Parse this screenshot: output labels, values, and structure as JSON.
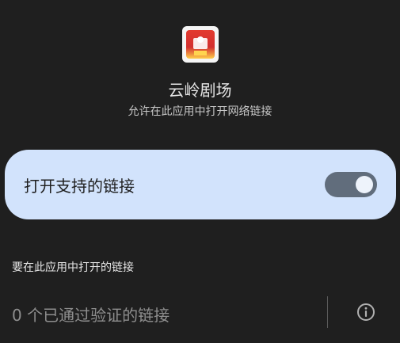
{
  "app": {
    "name": "云岭剧场",
    "icon_label": "云岭剧场",
    "subtitle": "允许在此应用中打开网络链接"
  },
  "setting": {
    "label": "打开支持的链接",
    "enabled": true,
    "accent_color": "#d2e3fc"
  },
  "links_section": {
    "title": "要在此应用中打开的链接",
    "verified_links_text": "0 个已通过验证的链接"
  },
  "icons": {
    "info": "info-icon"
  }
}
